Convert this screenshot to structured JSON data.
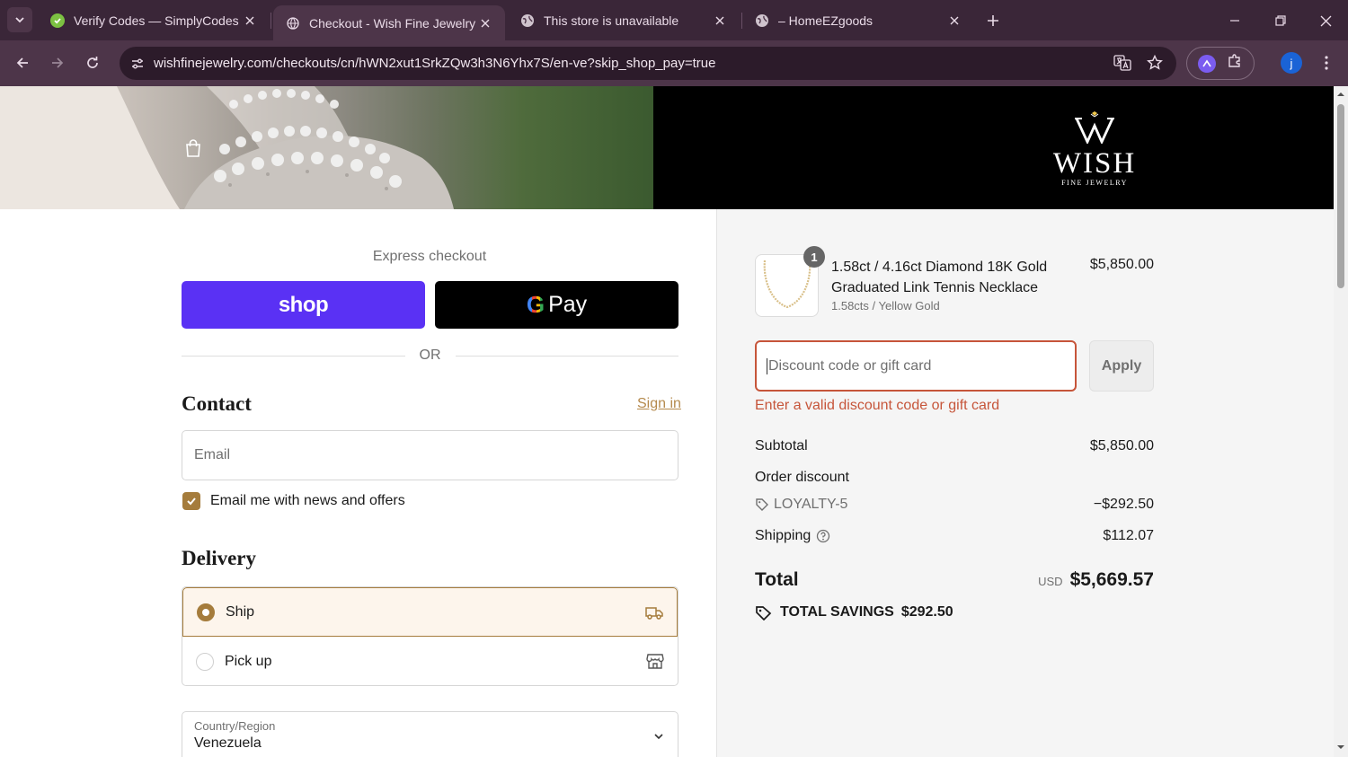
{
  "browser": {
    "tabs": [
      {
        "title": "Verify Codes — SimplyCodes",
        "active": false
      },
      {
        "title": "Checkout - Wish Fine Jewelry",
        "active": true
      },
      {
        "title": "This store is unavailable",
        "active": false
      },
      {
        "title": "– HomeEZgoods",
        "active": false
      }
    ],
    "url": "wishfinejewelry.com/checkouts/cn/hWN2xut1SrkZQw3h3N6Yhx7S/en-ve?skip_shop_pay=true",
    "profile_initial": "j"
  },
  "brand": {
    "name": "WISH",
    "tagline": "FINE JEWELRY"
  },
  "checkout": {
    "express_label": "Express checkout",
    "shop_pay_label": "shop",
    "gpay_g": "G",
    "gpay_label": "Pay",
    "or_label": "OR",
    "contact_heading": "Contact",
    "sign_in_label": "Sign in",
    "email_placeholder": "Email",
    "newsletter_label": "Email me with news and offers",
    "newsletter_checked": true,
    "delivery_heading": "Delivery",
    "delivery_options": [
      {
        "label": "Ship",
        "selected": true
      },
      {
        "label": "Pick up",
        "selected": false
      }
    ],
    "country_label": "Country/Region",
    "country_value": "Venezuela"
  },
  "summary": {
    "item": {
      "quantity": "1",
      "name": "1.58ct / 4.16ct Diamond 18K Gold Graduated Link Tennis Necklace",
      "variant": "1.58cts / Yellow Gold",
      "price": "$5,850.00"
    },
    "discount_placeholder": "Discount code or gift card",
    "apply_label": "Apply",
    "error": "Enter a valid discount code or gift card",
    "subtotal_label": "Subtotal",
    "subtotal_value": "$5,850.00",
    "order_discount_label": "Order discount",
    "discount_code": "LOYALTY-5",
    "discount_value": "−$292.50",
    "shipping_label": "Shipping",
    "shipping_value": "$112.07",
    "total_label": "Total",
    "total_currency": "USD",
    "total_value": "$5,669.57",
    "savings_label": "TOTAL SAVINGS",
    "savings_value": "$292.50"
  },
  "colors": {
    "accent": "#a57c3c",
    "error": "#c6553a",
    "shop_pay": "#5a31f4"
  }
}
